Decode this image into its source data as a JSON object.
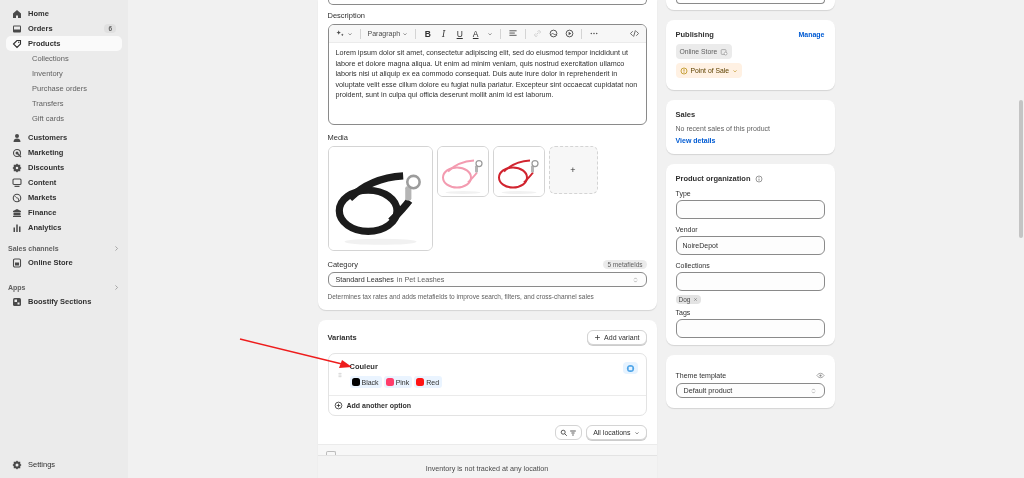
{
  "sidebar": {
    "nav": [
      {
        "label": "Home",
        "selected": false
      },
      {
        "label": "Orders",
        "selected": false,
        "badge": "6"
      },
      {
        "label": "Products",
        "selected": true,
        "children": [
          {
            "label": "Collections",
            "selected": false
          },
          {
            "label": "Inventory",
            "selected": false
          },
          {
            "label": "Purchase orders",
            "selected": false
          },
          {
            "label": "Transfers",
            "selected": false
          },
          {
            "label": "Gift cards",
            "selected": false
          }
        ]
      },
      {
        "label": "Customers",
        "selected": false
      },
      {
        "label": "Marketing",
        "selected": false
      },
      {
        "label": "Discounts",
        "selected": false
      },
      {
        "label": "Content",
        "selected": false
      },
      {
        "label": "Markets",
        "selected": false
      },
      {
        "label": "Finance",
        "selected": false
      },
      {
        "label": "Analytics",
        "selected": false
      }
    ],
    "sections": [
      {
        "title": "Sales channels",
        "items": [
          {
            "label": "Online Store",
            "selected": false
          }
        ]
      },
      {
        "title": "Apps",
        "items": [
          {
            "label": "Boostify Sections",
            "selected": false
          }
        ]
      }
    ],
    "settings": {
      "label": "Settings"
    }
  },
  "description": {
    "label": "Description",
    "format": "Paragraph",
    "marks": [
      "B",
      "I",
      "U",
      "A"
    ],
    "text": "Lorem ipsum dolor sit amet, consectetur adipiscing elit, sed do eiusmod tempor incididunt ut labore et dolore magna aliqua. Ut enim ad minim veniam, quis nostrud exercitation ullamco laboris nisi ut aliquip ex ea commodo consequat. Duis aute irure dolor in reprehenderit in voluptate velit esse cillum dolore eu fugiat nulla pariatur. Excepteur sint occaecat cupidatat non proident, sunt in culpa qui officia deserunt mollit anim id est laborum."
  },
  "media": {
    "label": "Media",
    "add": "+"
  },
  "category": {
    "label": "Category",
    "badge": "5 metafields",
    "value": "Standard Leashes",
    "path": "in Pet Leashes",
    "help": "Determines tax rates and adds metafields to improve search, filters, and cross-channel sales"
  },
  "variants": {
    "title": "Variants",
    "add_button": "Add variant",
    "option": {
      "name": "Couleur",
      "values": [
        {
          "label": "Black",
          "color": "#000000"
        },
        {
          "label": "Pink",
          "color": "#ff3d6a"
        },
        {
          "label": "Red",
          "color": "#ff1414"
        }
      ]
    },
    "add_option": "Add another option",
    "select_all": {
      "checked": false
    },
    "location_filter": "All locations",
    "inventory_note": "Inventory is not tracked at any location"
  },
  "publishing": {
    "title": "Publishing",
    "manage": "Manage",
    "channels": [
      {
        "label": "Online Store",
        "kind": "plain"
      },
      {
        "label": "Point of Sale",
        "kind": "warning"
      }
    ]
  },
  "sales": {
    "title": "Sales",
    "text": "No recent sales of this product",
    "link": "View details"
  },
  "organization": {
    "title": "Product organization",
    "fields": [
      {
        "label": "Type"
      },
      {
        "label": "Vendor",
        "value": "NoireDepot"
      },
      {
        "label": "Collections",
        "tags": [
          "Dog"
        ]
      },
      {
        "label": "Tags"
      }
    ]
  },
  "theme_template": {
    "title": "Theme template",
    "value": "Default product"
  }
}
